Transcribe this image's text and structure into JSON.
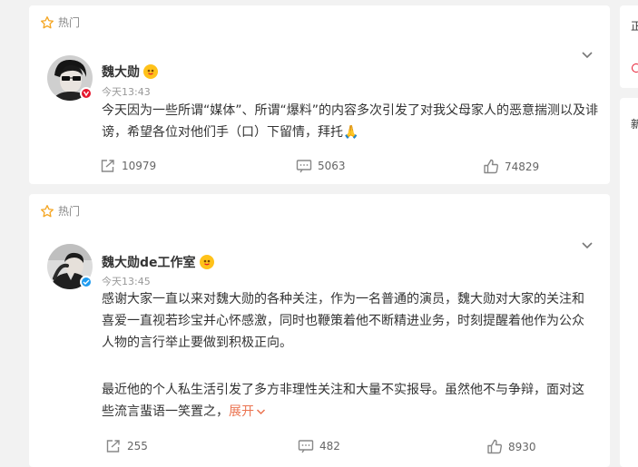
{
  "posts": [
    {
      "hot_label": "热门",
      "author": "魏大勋",
      "time": "今天13:43",
      "text_lines": [
        "今天因为一些所谓“媒体”、所谓“爆料”的内容多次引发了对我父母家人的恶意揣测以及诽",
        "谤，希望各位对他们手（口）下留情，拜托🙏"
      ],
      "reposts": "10979",
      "comments": "5063",
      "likes": "74829"
    },
    {
      "hot_label": "热门",
      "author": "魏大勋de工作室",
      "time": "今天13:45",
      "text_lines": [
        "感谢大家一直以来对魏大勋的各种关注，作为一名普通的演员，魏大勋对大家的关注和",
        "喜爱一直视若珍宝并心怀感激，同时也鞭策着他不断精进业务，时刻提醒着他作为公众",
        "人物的言行举止要做到积极正向。",
        "最近他的个人私生活引发了多方非理性关注和大量不实报导。虽然他不与争辩，面对这",
        "些流言蜚语一笑置之，"
      ],
      "expand_label": "展开",
      "reposts": "255",
      "comments": "482",
      "likes": "8930"
    }
  ],
  "right_panel": {
    "top_char": "正",
    "second_char": "新"
  },
  "colors": {
    "accent": "#eb7350",
    "badge_red": "#e6162d",
    "badge_blue": "#1e9bf0",
    "member_gold": "#ffc21a"
  }
}
